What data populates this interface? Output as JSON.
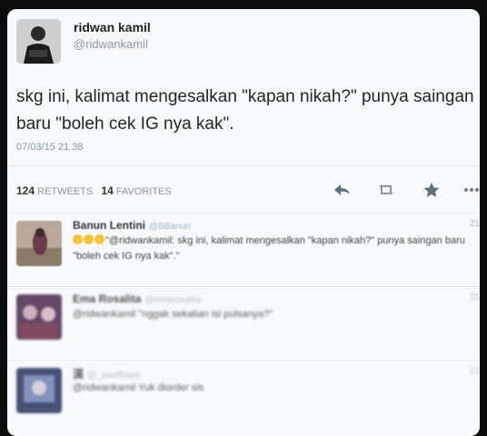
{
  "tweet": {
    "author_name": "ridwan kamil",
    "author_handle": "@ridwankamil",
    "text": "skg ini, kalimat mengesalkan \"kapan nikah?\" punya saingan baru \"boleh cek IG nya kak\".",
    "timestamp": "07/03/15 21.38",
    "retweets_count": "124",
    "retweets_label": "RETWEETS",
    "favorites_count": "14",
    "favorites_label": "FAVORITES"
  },
  "actions": {
    "reply_icon": "reply-icon",
    "retweet_icon": "retweet-icon",
    "favorite_icon": "star-icon",
    "more_icon": "more-icon"
  },
  "replies": [
    {
      "name": "Banun Lentini",
      "handle": "@BBanun",
      "time": "21",
      "emoji_count": 3,
      "text": "\"@ridwankamil: skg ini, kalimat mengesalkan \"kapan nikah?\" punya saingan baru \"boleh cek IG nya kak\".\""
    },
    {
      "name": "Ema Rosalita",
      "handle": "@emarosalita",
      "time": "21",
      "text": "@ridwankamil \"nggak sekalian isi pulsanya?\""
    },
    {
      "name": "渓",
      "handle": "@_suciftriani",
      "time": "21",
      "text": "@ridwankamil Yuk diorder sis"
    }
  ],
  "colors": {
    "card_bg": "#f7f8f9",
    "text": "#252525",
    "muted": "#8a96a2",
    "action_icon": "#5e7180",
    "background": "#0b0b0b"
  }
}
